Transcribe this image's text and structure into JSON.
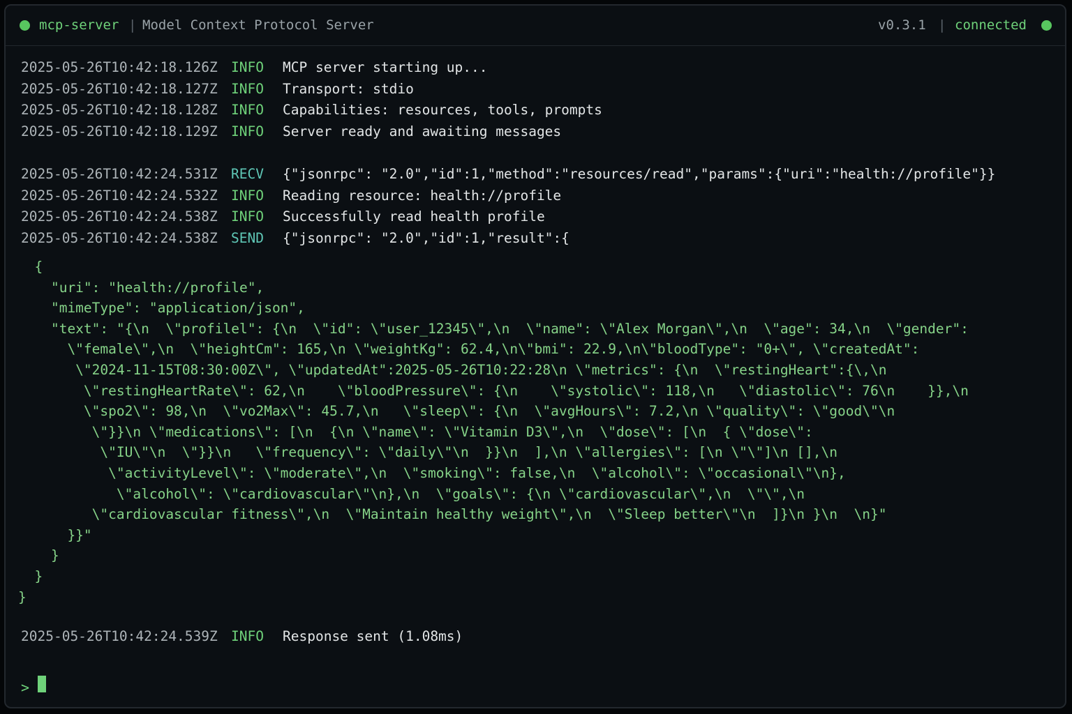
{
  "titlebar": {
    "app_name": "mcp-server",
    "separator": "|",
    "subtitle": "Model Context Protocol Server",
    "version": "v0.3.1",
    "status": "connected",
    "status_color": "#58c65f"
  },
  "log": [
    {
      "ts": "2025-05-26T10:42:18.126Z",
      "level": "INFO",
      "msg": "MCP server starting up..."
    },
    {
      "ts": "2025-05-26T10:42:18.127Z",
      "level": "INFO",
      "msg": "Transport: stdio"
    },
    {
      "ts": "2025-05-26T10:42:18.128Z",
      "level": "INFO",
      "msg": "Capabilities: resources, tools, prompts"
    },
    {
      "ts": "2025-05-26T10:42:18.129Z",
      "level": "INFO",
      "msg": "Server ready and awaiting messages"
    },
    {
      "ts": "",
      "level": "",
      "msg": ""
    },
    {
      "ts": "2025-05-26T10:42:24.531Z",
      "level": "RECV",
      "msg": "{\"jsonrpc\": \"2.0\",\"id\":1,\"method\":\"resources/read\",\"params\":{\"uri\":\"health://profile\"}}"
    },
    {
      "ts": "2025-05-26T10:42:24.532Z",
      "level": "INFO",
      "msg": "Reading resource: health://profile"
    },
    {
      "ts": "2025-05-26T10:42:24.538Z",
      "level": "INFO",
      "msg": "Successfully read health profile"
    },
    {
      "ts": "2025-05-26T10:42:24.538Z",
      "level": "SEND",
      "msg": "{\"jsonrpc\": \"2.0\",\"id\":1,\"result\":{"
    }
  ],
  "json_body": [
    "  {",
    "    \"uri\": \"health://profile\",",
    "    \"mimeType\": \"application/json\",",
    "    \"text\": \"{\\n  \\\"profilel\": {\\n  \\\"id\": \\\"user_12345\\\",\\n  \\\"name\": \\\"Alex Morgan\\\",\\n  \\\"age\": 34,\\n  \\\"gender\":",
    "      \\\"female\\\",\\n  \\\"heightCm\": 165,\\n \\\"weightKg\": 62.4,\\n\\\"bmi\": 22.9,\\n\\\"bloodType\": \"0+\\\", \\\"createdAt\":",
    "       \\\"2024-11-15T08:30:00Z\\\", \\\"updatedAt\":2025-05-26T10:22:28\\n \\\"metrics\": {\\n  \\\"restingHeart\":{\\,\\n",
    "        \\\"restingHeartRate\\\": 62,\\n    \\\"bloodPressure\\\": {\\n    \\\"systolic\\\": 118,\\n   \\\"diastolic\\\": 76\\n    }},\\n",
    "        \\\"spo2\\\": 98,\\n  \\\"vo2Max\\\": 45.7,\\n   \\\"sleep\\\": {\\n  \\\"avgHours\\\": 7.2,\\n \\\"quality\\\": \\\"good\\\"\\n",
    "         \\\"}}\\n \\\"medications\\\": [\\n  {\\n \\\"name\\\": \\\"Vitamin D3\\\",\\n  \\\"dose\\\": [\\n  { \\\"dose\\\":",
    "          \\\"IU\\\"\\n  \\\"}}\\n   \\\"frequency\\\": \\\"daily\\\"\\n  }}\\n  ],\\n \\\"allergies\\\": [\\n \\\"\\\"]\\n [],\\n",
    "           \\\"activityLevel\\\": \\\"moderate\\\",\\n  \\\"smoking\\\": false,\\n  \\\"alcohol\\\": \\\"occasional\\\"\\n},",
    "            \\\"alcohol\\\": \\\"cardiovascular\\\"\\n},\\n  \\\"goals\\\": {\\n \\\"cardiovascular\\\",\\n  \\\"\\\",\\n",
    "         \\\"cardiovascular fitness\\\",\\n  \\\"Maintain healthy weight\\\",\\n  \\\"Sleep better\\\"\\n  ]}\\n }\\n  \\n}\"",
    "      }}\"",
    "    }",
    "  }",
    "}"
  ],
  "final_line": {
    "ts": "2025-05-26T10:42:24.539Z",
    "level": "INFO",
    "msg": "Response sent (1.08ms)"
  },
  "prompt": {
    "symbol": ">"
  }
}
